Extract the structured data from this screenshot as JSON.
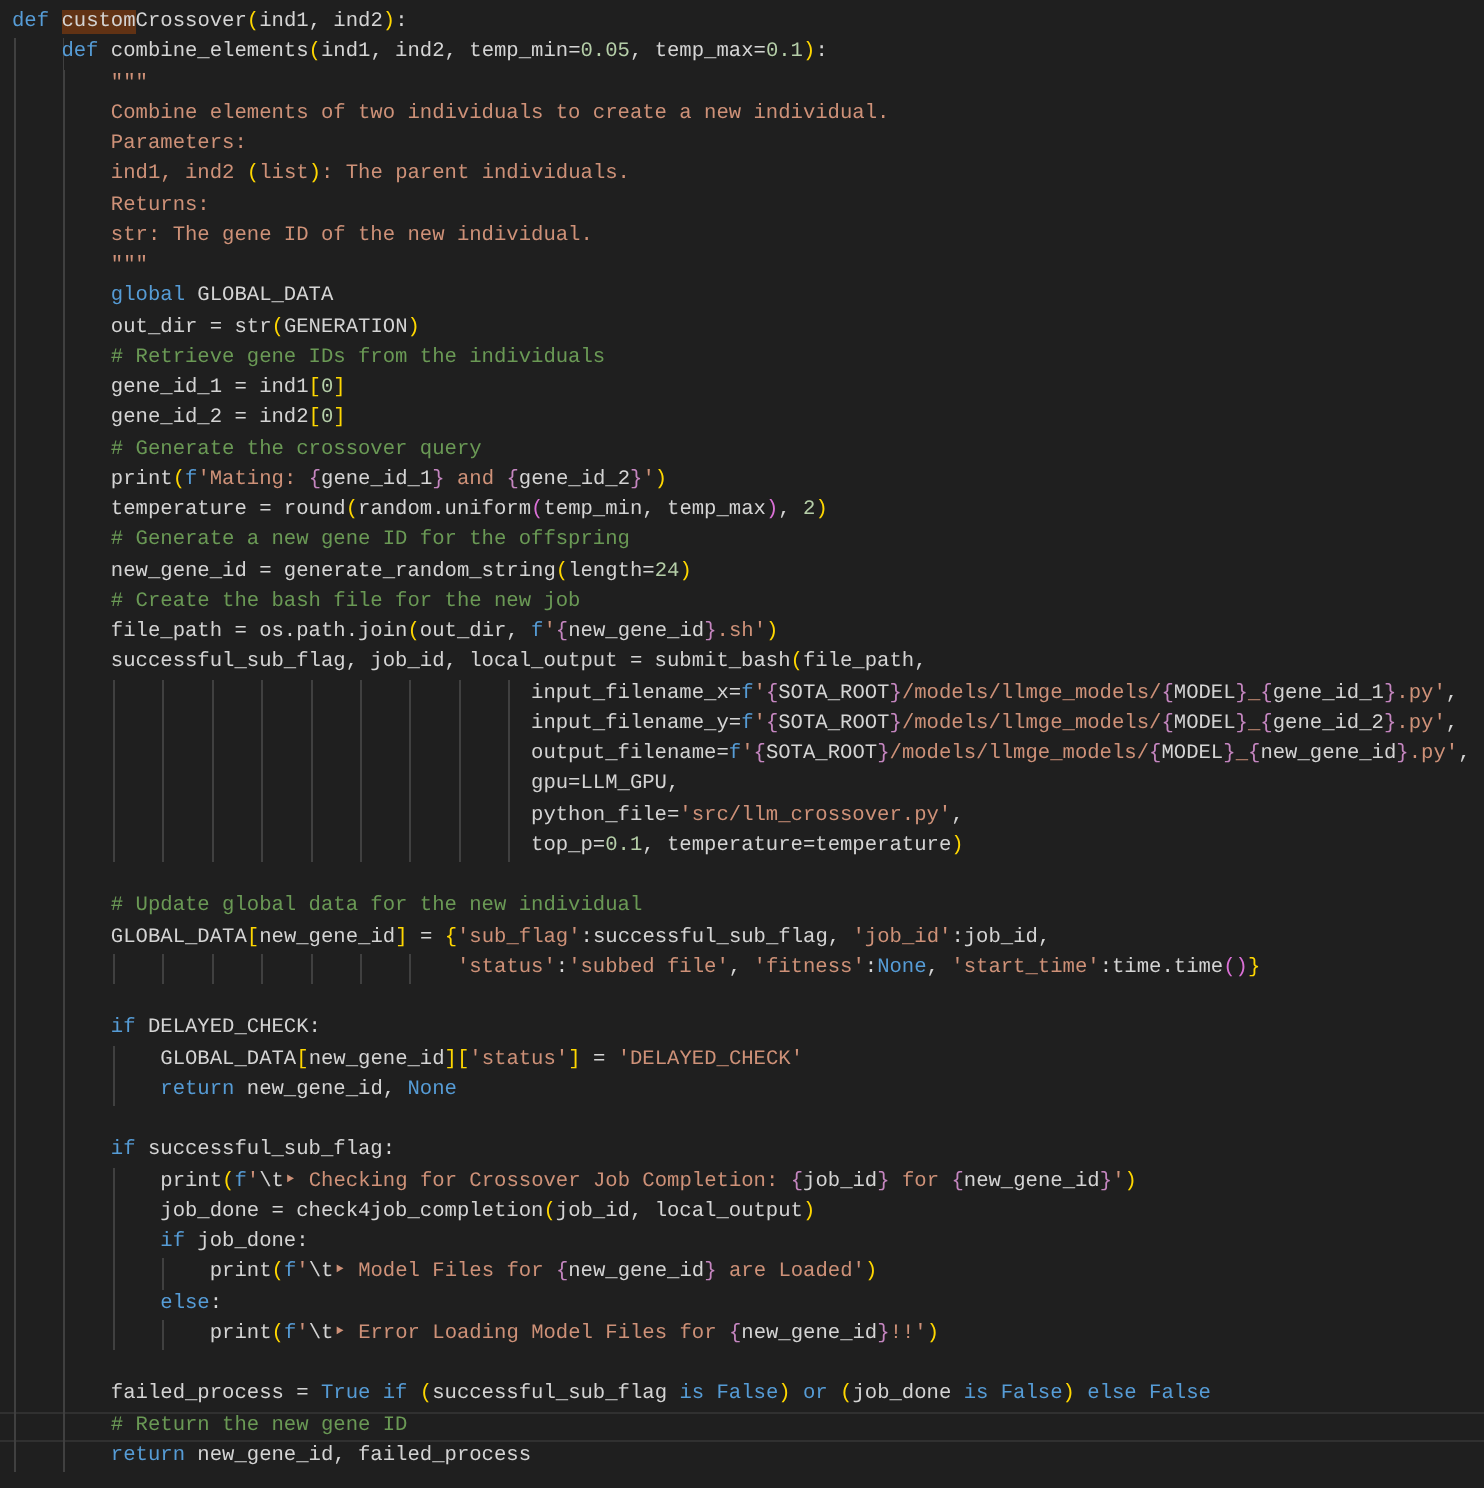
{
  "editor": {
    "lines": [
      {
        "current": false,
        "tokens": [
          {
            "kind": "kw",
            "text": "def "
          },
          {
            "kind": "match",
            "text": "custom"
          },
          {
            "kind": "tx",
            "text": "Crossover"
          },
          {
            "kind": "b1",
            "text": "("
          },
          {
            "kind": "tx",
            "text": "ind1, ind2"
          },
          {
            "kind": "b1",
            "text": ")"
          },
          {
            "kind": "tx",
            "text": ":"
          }
        ]
      },
      {
        "current": false,
        "tokens": [
          {
            "kind": "kw",
            "text": "    def"
          },
          {
            "kind": "tx",
            "text": " combine_elements"
          },
          {
            "kind": "b1",
            "text": "("
          },
          {
            "kind": "tx",
            "text": "ind1, ind2, temp_min="
          },
          {
            "kind": "num",
            "text": "0.05"
          },
          {
            "kind": "tx",
            "text": ", temp_max="
          },
          {
            "kind": "num",
            "text": "0.1"
          },
          {
            "kind": "b1",
            "text": ")"
          },
          {
            "kind": "tx",
            "text": ":"
          }
        ]
      },
      {
        "current": false,
        "tokens": [
          {
            "kind": "str",
            "text": "        \"\"\""
          }
        ]
      },
      {
        "current": false,
        "tokens": [
          {
            "kind": "str",
            "text": "        Combine elements of two individuals to create a new individual."
          }
        ]
      },
      {
        "current": false,
        "tokens": [
          {
            "kind": "str",
            "text": "        Parameters:"
          }
        ]
      },
      {
        "current": false,
        "tokens": [
          {
            "kind": "str",
            "text": "        ind1, ind2 "
          },
          {
            "kind": "b1",
            "text": "("
          },
          {
            "kind": "str",
            "text": "list"
          },
          {
            "kind": "b1",
            "text": ")"
          },
          {
            "kind": "str",
            "text": ": The parent individuals."
          }
        ]
      },
      {
        "current": false,
        "tokens": [
          {
            "kind": "str",
            "text": "        Returns:"
          }
        ]
      },
      {
        "current": false,
        "tokens": [
          {
            "kind": "str",
            "text": "        str: The gene ID of the new individual."
          }
        ]
      },
      {
        "current": false,
        "tokens": [
          {
            "kind": "str",
            "text": "        \"\"\""
          }
        ]
      },
      {
        "current": false,
        "tokens": [
          {
            "kind": "kw",
            "text": "        global"
          },
          {
            "kind": "tx",
            "text": " GLOBAL_DATA"
          }
        ]
      },
      {
        "current": false,
        "tokens": [
          {
            "kind": "tx",
            "text": "        out_dir = str"
          },
          {
            "kind": "b1",
            "text": "("
          },
          {
            "kind": "tx",
            "text": "GENERATION"
          },
          {
            "kind": "b1",
            "text": ")"
          }
        ]
      },
      {
        "current": false,
        "tokens": [
          {
            "kind": "cm",
            "text": "        # Retrieve gene IDs from the individuals"
          }
        ]
      },
      {
        "current": false,
        "tokens": [
          {
            "kind": "tx",
            "text": "        gene_id_1 = ind1"
          },
          {
            "kind": "b1",
            "text": "["
          },
          {
            "kind": "num",
            "text": "0"
          },
          {
            "kind": "b1",
            "text": "]"
          }
        ]
      },
      {
        "current": false,
        "tokens": [
          {
            "kind": "tx",
            "text": "        gene_id_2 = ind2"
          },
          {
            "kind": "b1",
            "text": "["
          },
          {
            "kind": "num",
            "text": "0"
          },
          {
            "kind": "b1",
            "text": "]"
          }
        ]
      },
      {
        "current": false,
        "tokens": [
          {
            "kind": "cm",
            "text": "        # Generate the crossover query"
          }
        ]
      },
      {
        "current": false,
        "tokens": [
          {
            "kind": "tx",
            "text": "        print"
          },
          {
            "kind": "b1",
            "text": "("
          },
          {
            "kind": "kw",
            "text": "f"
          },
          {
            "kind": "str",
            "text": "'Mating: "
          },
          {
            "kind": "fb",
            "text": "{"
          },
          {
            "kind": "tx",
            "text": "gene_id_1"
          },
          {
            "kind": "fb",
            "text": "}"
          },
          {
            "kind": "str",
            "text": " and "
          },
          {
            "kind": "fb",
            "text": "{"
          },
          {
            "kind": "tx",
            "text": "gene_id_2"
          },
          {
            "kind": "fb",
            "text": "}"
          },
          {
            "kind": "str",
            "text": "'"
          },
          {
            "kind": "b1",
            "text": ")"
          }
        ]
      },
      {
        "current": false,
        "tokens": [
          {
            "kind": "tx",
            "text": "        temperature = round"
          },
          {
            "kind": "b1",
            "text": "("
          },
          {
            "kind": "tx",
            "text": "random.uniform"
          },
          {
            "kind": "b2",
            "text": "("
          },
          {
            "kind": "tx",
            "text": "temp_min, temp_max"
          },
          {
            "kind": "b2",
            "text": ")"
          },
          {
            "kind": "tx",
            "text": ", "
          },
          {
            "kind": "num",
            "text": "2"
          },
          {
            "kind": "b1",
            "text": ")"
          }
        ]
      },
      {
        "current": false,
        "tokens": [
          {
            "kind": "cm",
            "text": "        # Generate a new gene ID for the offspring"
          }
        ]
      },
      {
        "current": false,
        "tokens": [
          {
            "kind": "tx",
            "text": "        new_gene_id = generate_random_string"
          },
          {
            "kind": "b1",
            "text": "("
          },
          {
            "kind": "tx",
            "text": "length="
          },
          {
            "kind": "num",
            "text": "24"
          },
          {
            "kind": "b1",
            "text": ")"
          }
        ]
      },
      {
        "current": false,
        "tokens": [
          {
            "kind": "cm",
            "text": "        # Create the bash file for the new job"
          }
        ]
      },
      {
        "current": false,
        "tokens": [
          {
            "kind": "tx",
            "text": "        file_path = os.path.join"
          },
          {
            "kind": "b1",
            "text": "("
          },
          {
            "kind": "tx",
            "text": "out_dir, "
          },
          {
            "kind": "kw",
            "text": "f"
          },
          {
            "kind": "str",
            "text": "'"
          },
          {
            "kind": "fb",
            "text": "{"
          },
          {
            "kind": "tx",
            "text": "new_gene_id"
          },
          {
            "kind": "fb",
            "text": "}"
          },
          {
            "kind": "str",
            "text": ".sh'"
          },
          {
            "kind": "b1",
            "text": ")"
          }
        ]
      },
      {
        "current": false,
        "tokens": [
          {
            "kind": "tx",
            "text": "        successful_sub_flag, job_id, local_output = submit_bash"
          },
          {
            "kind": "b1",
            "text": "("
          },
          {
            "kind": "tx",
            "text": "file_path,"
          }
        ]
      },
      {
        "current": false,
        "tokens": [
          {
            "kind": "tx",
            "text": "                                          input_filename_x="
          },
          {
            "kind": "kw",
            "text": "f"
          },
          {
            "kind": "str",
            "text": "'"
          },
          {
            "kind": "fb",
            "text": "{"
          },
          {
            "kind": "tx",
            "text": "SOTA_ROOT"
          },
          {
            "kind": "fb",
            "text": "}"
          },
          {
            "kind": "str",
            "text": "/models/llmge_models/"
          },
          {
            "kind": "fb",
            "text": "{"
          },
          {
            "kind": "tx",
            "text": "MODEL"
          },
          {
            "kind": "fb",
            "text": "}"
          },
          {
            "kind": "str",
            "text": "_"
          },
          {
            "kind": "fb",
            "text": "{"
          },
          {
            "kind": "tx",
            "text": "gene_id_1"
          },
          {
            "kind": "fb",
            "text": "}"
          },
          {
            "kind": "str",
            "text": ".py'"
          },
          {
            "kind": "tx",
            "text": ","
          }
        ]
      },
      {
        "current": false,
        "tokens": [
          {
            "kind": "tx",
            "text": "                                          input_filename_y="
          },
          {
            "kind": "kw",
            "text": "f"
          },
          {
            "kind": "str",
            "text": "'"
          },
          {
            "kind": "fb",
            "text": "{"
          },
          {
            "kind": "tx",
            "text": "SOTA_ROOT"
          },
          {
            "kind": "fb",
            "text": "}"
          },
          {
            "kind": "str",
            "text": "/models/llmge_models/"
          },
          {
            "kind": "fb",
            "text": "{"
          },
          {
            "kind": "tx",
            "text": "MODEL"
          },
          {
            "kind": "fb",
            "text": "}"
          },
          {
            "kind": "str",
            "text": "_"
          },
          {
            "kind": "fb",
            "text": "{"
          },
          {
            "kind": "tx",
            "text": "gene_id_2"
          },
          {
            "kind": "fb",
            "text": "}"
          },
          {
            "kind": "str",
            "text": ".py'"
          },
          {
            "kind": "tx",
            "text": ","
          }
        ]
      },
      {
        "current": false,
        "tokens": [
          {
            "kind": "tx",
            "text": "                                          output_filename="
          },
          {
            "kind": "kw",
            "text": "f"
          },
          {
            "kind": "str",
            "text": "'"
          },
          {
            "kind": "fb",
            "text": "{"
          },
          {
            "kind": "tx",
            "text": "SOTA_ROOT"
          },
          {
            "kind": "fb",
            "text": "}"
          },
          {
            "kind": "str",
            "text": "/models/llmge_models/"
          },
          {
            "kind": "fb",
            "text": "{"
          },
          {
            "kind": "tx",
            "text": "MODEL"
          },
          {
            "kind": "fb",
            "text": "}"
          },
          {
            "kind": "str",
            "text": "_"
          },
          {
            "kind": "fb",
            "text": "{"
          },
          {
            "kind": "tx",
            "text": "new_gene_id"
          },
          {
            "kind": "fb",
            "text": "}"
          },
          {
            "kind": "str",
            "text": ".py'"
          },
          {
            "kind": "tx",
            "text": ","
          }
        ]
      },
      {
        "current": false,
        "tokens": [
          {
            "kind": "tx",
            "text": "                                          gpu=LLM_GPU,"
          }
        ]
      },
      {
        "current": false,
        "tokens": [
          {
            "kind": "tx",
            "text": "                                          python_file="
          },
          {
            "kind": "str",
            "text": "'src/llm_crossover.py'"
          },
          {
            "kind": "tx",
            "text": ","
          }
        ]
      },
      {
        "current": false,
        "tokens": [
          {
            "kind": "tx",
            "text": "                                          top_p="
          },
          {
            "kind": "num",
            "text": "0.1"
          },
          {
            "kind": "tx",
            "text": ", temperature=temperature"
          },
          {
            "kind": "b1",
            "text": ")"
          }
        ]
      },
      {
        "current": false
      },
      {
        "current": false,
        "tokens": [
          {
            "kind": "cm",
            "text": "        # Update global data for the new individual"
          }
        ]
      },
      {
        "current": false,
        "tokens": [
          {
            "kind": "tx",
            "text": "        GLOBAL_DATA"
          },
          {
            "kind": "b1",
            "text": "["
          },
          {
            "kind": "tx",
            "text": "new_gene_id"
          },
          {
            "kind": "b1",
            "text": "]"
          },
          {
            "kind": "tx",
            "text": " = "
          },
          {
            "kind": "b1",
            "text": "{"
          },
          {
            "kind": "str",
            "text": "'sub_flag'"
          },
          {
            "kind": "tx",
            "text": ":successful_sub_flag, "
          },
          {
            "kind": "str",
            "text": "'job_id'"
          },
          {
            "kind": "tx",
            "text": ":job_id,"
          }
        ]
      },
      {
        "current": false,
        "tokens": [
          {
            "kind": "str",
            "text": "                                    'status'"
          },
          {
            "kind": "tx",
            "text": ":"
          },
          {
            "kind": "str",
            "text": "'subbed file'"
          },
          {
            "kind": "tx",
            "text": ", "
          },
          {
            "kind": "str",
            "text": "'fitness'"
          },
          {
            "kind": "tx",
            "text": ":"
          },
          {
            "kind": "kw",
            "text": "None"
          },
          {
            "kind": "tx",
            "text": ", "
          },
          {
            "kind": "str",
            "text": "'start_time'"
          },
          {
            "kind": "tx",
            "text": ":time.time"
          },
          {
            "kind": "b2",
            "text": "()"
          },
          {
            "kind": "b1",
            "text": "}"
          }
        ]
      },
      {
        "current": false
      },
      {
        "current": false,
        "tokens": [
          {
            "kind": "kw",
            "text": "        if"
          },
          {
            "kind": "tx",
            "text": " DELAYED_CHECK:"
          }
        ]
      },
      {
        "current": false,
        "tokens": [
          {
            "kind": "tx",
            "text": "            GLOBAL_DATA"
          },
          {
            "kind": "b1",
            "text": "["
          },
          {
            "kind": "tx",
            "text": "new_gene_id"
          },
          {
            "kind": "b1",
            "text": "]["
          },
          {
            "kind": "str",
            "text": "'status'"
          },
          {
            "kind": "b1",
            "text": "]"
          },
          {
            "kind": "tx",
            "text": " = "
          },
          {
            "kind": "str",
            "text": "'DELAYED_CHECK'"
          }
        ]
      },
      {
        "current": false,
        "tokens": [
          {
            "kind": "kw",
            "text": "            return"
          },
          {
            "kind": "tx",
            "text": " new_gene_id, "
          },
          {
            "kind": "kw",
            "text": "None"
          }
        ]
      },
      {
        "current": false
      },
      {
        "current": false,
        "tokens": [
          {
            "kind": "kw",
            "text": "        if"
          },
          {
            "kind": "tx",
            "text": " successful_sub_flag:"
          }
        ]
      },
      {
        "current": false,
        "tokens": [
          {
            "kind": "tx",
            "text": "            print"
          },
          {
            "kind": "b1",
            "text": "("
          },
          {
            "kind": "kw",
            "text": "f"
          },
          {
            "kind": "str",
            "text": "'"
          },
          {
            "kind": "tx",
            "text": "\\t"
          },
          {
            "kind": "str",
            "text": "‣ Checking for Crossover Job Completion: "
          },
          {
            "kind": "fb",
            "text": "{"
          },
          {
            "kind": "tx",
            "text": "job_id"
          },
          {
            "kind": "fb",
            "text": "}"
          },
          {
            "kind": "str",
            "text": " for "
          },
          {
            "kind": "fb",
            "text": "{"
          },
          {
            "kind": "tx",
            "text": "new_gene_id"
          },
          {
            "kind": "fb",
            "text": "}"
          },
          {
            "kind": "str",
            "text": "'"
          },
          {
            "kind": "b1",
            "text": ")"
          }
        ]
      },
      {
        "current": false,
        "tokens": [
          {
            "kind": "tx",
            "text": "            job_done = check4job_completion"
          },
          {
            "kind": "b1",
            "text": "("
          },
          {
            "kind": "tx",
            "text": "job_id, local_output"
          },
          {
            "kind": "b1",
            "text": ")"
          }
        ]
      },
      {
        "current": false,
        "tokens": [
          {
            "kind": "kw",
            "text": "            if"
          },
          {
            "kind": "tx",
            "text": " job_done:"
          }
        ]
      },
      {
        "current": false,
        "tokens": [
          {
            "kind": "tx",
            "text": "                print"
          },
          {
            "kind": "b1",
            "text": "("
          },
          {
            "kind": "kw",
            "text": "f"
          },
          {
            "kind": "str",
            "text": "'"
          },
          {
            "kind": "tx",
            "text": "\\t"
          },
          {
            "kind": "str",
            "text": "‣ Model Files for "
          },
          {
            "kind": "fb",
            "text": "{"
          },
          {
            "kind": "tx",
            "text": "new_gene_id"
          },
          {
            "kind": "fb",
            "text": "}"
          },
          {
            "kind": "str",
            "text": " are Loaded'"
          },
          {
            "kind": "b1",
            "text": ")"
          }
        ]
      },
      {
        "current": false,
        "tokens": [
          {
            "kind": "kw",
            "text": "            else"
          },
          {
            "kind": "tx",
            "text": ":"
          }
        ]
      },
      {
        "current": false,
        "tokens": [
          {
            "kind": "tx",
            "text": "                print"
          },
          {
            "kind": "b1",
            "text": "("
          },
          {
            "kind": "kw",
            "text": "f"
          },
          {
            "kind": "str",
            "text": "'"
          },
          {
            "kind": "tx",
            "text": "\\t"
          },
          {
            "kind": "str",
            "text": "‣ Error Loading Model Files for "
          },
          {
            "kind": "fb",
            "text": "{"
          },
          {
            "kind": "tx",
            "text": "new_gene_id"
          },
          {
            "kind": "fb",
            "text": "}"
          },
          {
            "kind": "str",
            "text": "!!'"
          },
          {
            "kind": "b1",
            "text": ")"
          }
        ]
      },
      {
        "current": false
      },
      {
        "current": false,
        "tokens": [
          {
            "kind": "tx",
            "text": "        failed_process = "
          },
          {
            "kind": "kw",
            "text": "True"
          },
          {
            "kind": "kw",
            "text": " if"
          },
          {
            "kind": "b1",
            "text": " ("
          },
          {
            "kind": "tx",
            "text": "successful_sub_flag "
          },
          {
            "kind": "kw",
            "text": "is False"
          },
          {
            "kind": "b1",
            "text": ")"
          },
          {
            "kind": "kw",
            "text": " or"
          },
          {
            "kind": "b1",
            "text": " ("
          },
          {
            "kind": "tx",
            "text": "job_done "
          },
          {
            "kind": "kw",
            "text": "is False"
          },
          {
            "kind": "b1",
            "text": ")"
          },
          {
            "kind": "kw",
            "text": " else False"
          }
        ]
      },
      {
        "current": true,
        "tokens": [
          {
            "kind": "cm",
            "text": "        # Return the new gene ID"
          }
        ]
      },
      {
        "current": false,
        "tokens": [
          {
            "kind": "kw",
            "text": "        return"
          },
          {
            "kind": "tx",
            "text": " new_gene_id, failed_process"
          }
        ]
      }
    ]
  }
}
